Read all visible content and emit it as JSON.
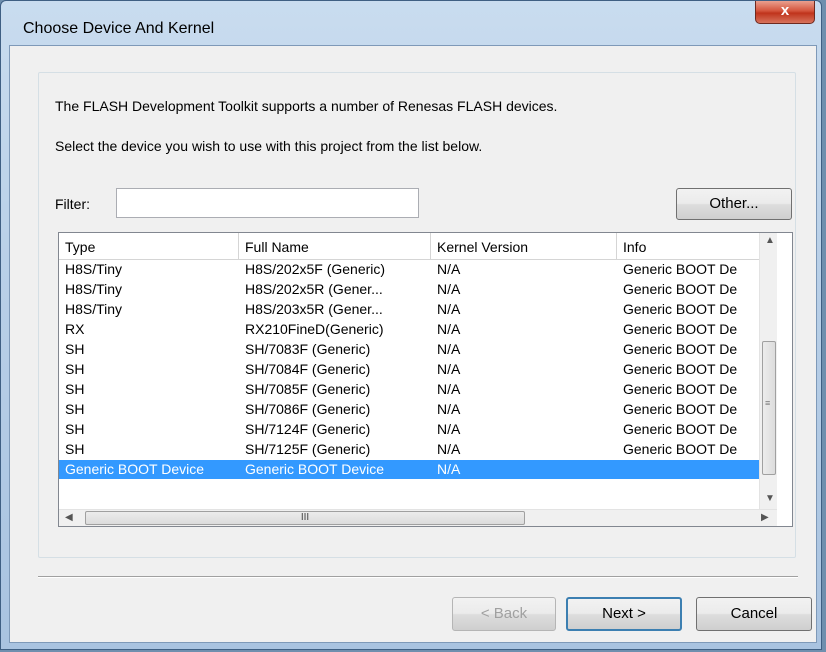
{
  "window": {
    "title": "Choose Device And Kernel",
    "close_label": "x"
  },
  "intro": {
    "line1": "The FLASH Development Toolkit supports a number of Renesas FLASH devices.",
    "line2": "Select the device you wish to use with this project from the list below."
  },
  "filter": {
    "label": "Filter:",
    "value": "",
    "placeholder": ""
  },
  "buttons": {
    "other": "Other...",
    "back": "< Back",
    "next": "Next >",
    "cancel": "Cancel"
  },
  "table": {
    "columns": [
      "Type",
      "Full Name",
      "Kernel Version",
      "Info"
    ],
    "rows": [
      [
        "H8S/Tiny",
        "H8S/202x5F (Generic)",
        "N/A",
        "Generic BOOT De"
      ],
      [
        "H8S/Tiny",
        "H8S/202x5R (Gener...",
        "N/A",
        "Generic BOOT De"
      ],
      [
        "H8S/Tiny",
        "H8S/203x5R (Gener...",
        "N/A",
        "Generic BOOT De"
      ],
      [
        "RX",
        "RX210FineD(Generic)",
        "N/A",
        "Generic BOOT De"
      ],
      [
        "SH",
        "SH/7083F (Generic)",
        "N/A",
        "Generic BOOT De"
      ],
      [
        "SH",
        "SH/7084F (Generic)",
        "N/A",
        "Generic BOOT De"
      ],
      [
        "SH",
        "SH/7085F (Generic)",
        "N/A",
        "Generic BOOT De"
      ],
      [
        "SH",
        "SH/7086F (Generic)",
        "N/A",
        "Generic BOOT De"
      ],
      [
        "SH",
        "SH/7124F (Generic)",
        "N/A",
        "Generic BOOT De"
      ],
      [
        "SH",
        "SH/7125F (Generic)",
        "N/A",
        "Generic BOOT De"
      ],
      [
        "Generic BOOT Device",
        "Generic BOOT Device",
        "N/A",
        ""
      ]
    ],
    "selected_row": 10,
    "hscroll_grip": "III"
  },
  "colors": {
    "selection": "#3399ff",
    "title_close": "#c7402a"
  }
}
